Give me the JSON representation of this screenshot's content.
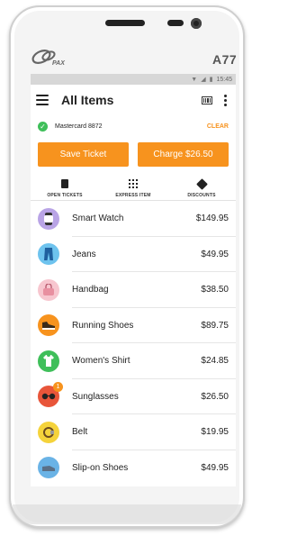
{
  "device": {
    "brand": "PAX",
    "model": "A77"
  },
  "status_bar": {
    "time": "15:45"
  },
  "header": {
    "title": "All Items"
  },
  "customer": {
    "card_label": "Mastercard 8872",
    "clear_label": "CLEAR"
  },
  "actions": {
    "save_label": "Save Ticket",
    "charge_label": "Charge $26.50"
  },
  "shortcuts": [
    {
      "label": "OPEN TICKETS",
      "icon": "ticket-icon"
    },
    {
      "label": "EXPRESS ITEM",
      "icon": "grid-icon"
    },
    {
      "label": "DISCOUNTS",
      "icon": "tag-icon"
    }
  ],
  "items": [
    {
      "name": "Smart Watch",
      "price": "$149.95",
      "color": "#b9a4e6",
      "icon": "smartwatch-icon"
    },
    {
      "name": "Jeans",
      "price": "$49.95",
      "color": "#6ec3ee",
      "icon": "jeans-icon"
    },
    {
      "name": "Handbag",
      "price": "$38.50",
      "color": "#f7c6cf",
      "icon": "handbag-icon"
    },
    {
      "name": "Running Shoes",
      "price": "$89.75",
      "color": "#f7931e",
      "icon": "running-shoe-icon"
    },
    {
      "name": "Women's Shirt",
      "price": "$24.85",
      "color": "#3fbf5a",
      "icon": "shirt-icon"
    },
    {
      "name": "Sunglasses",
      "price": "$26.50",
      "color": "#e8553a",
      "icon": "sunglasses-icon",
      "badge": "1"
    },
    {
      "name": "Belt",
      "price": "$19.95",
      "color": "#f5d33b",
      "icon": "belt-icon"
    },
    {
      "name": "Slip-on Shoes",
      "price": "$49.95",
      "color": "#6ab3e6",
      "icon": "slip-on-shoe-icon"
    }
  ],
  "colors": {
    "accent": "#f7931e",
    "success": "#3fbf5a"
  }
}
